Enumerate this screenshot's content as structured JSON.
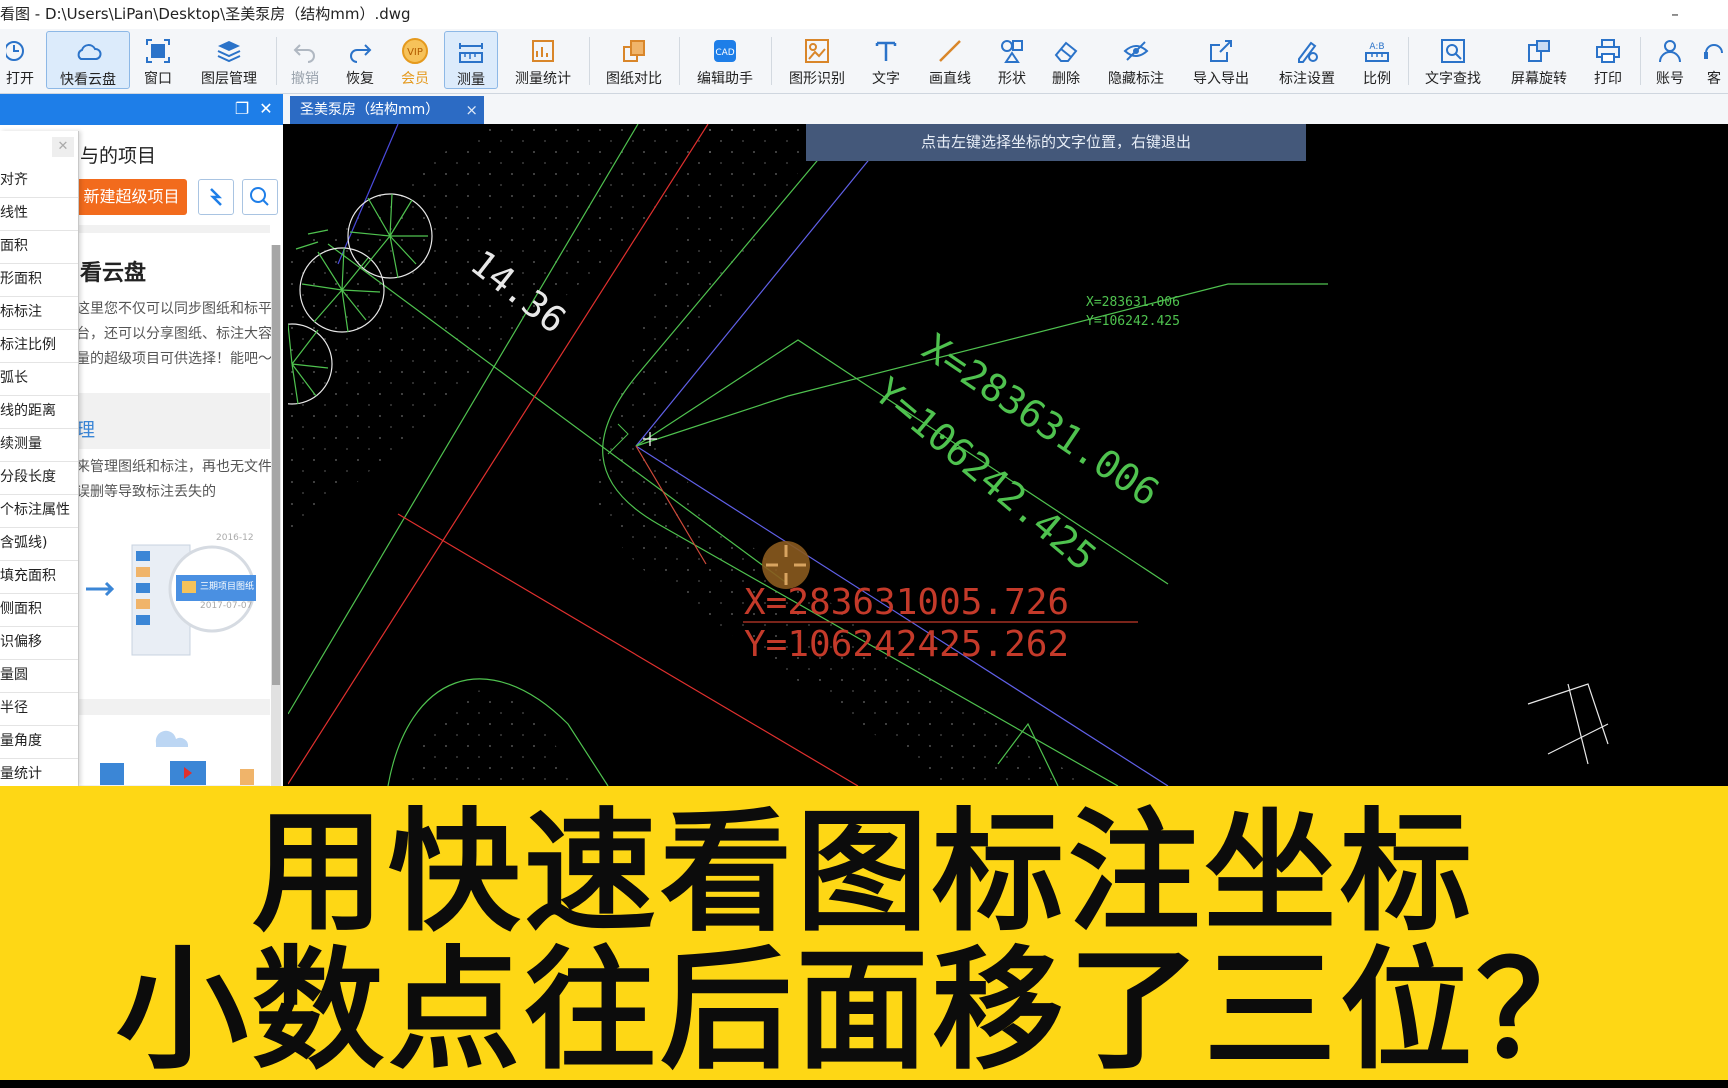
{
  "window": {
    "title": "看图 - D:\\Users\\LiPan\\Desktop\\圣美泵房（结构mm）.dwg",
    "minimize": "–"
  },
  "toolbar": {
    "items": [
      {
        "label": "打开",
        "icon": "clock-icon"
      },
      {
        "label": "快看云盘",
        "icon": "cloud-icon"
      },
      {
        "label": "窗口",
        "icon": "window-icon"
      },
      {
        "label": "图层管理",
        "icon": "layers-icon"
      },
      {
        "label": "撤销",
        "icon": "undo-icon"
      },
      {
        "label": "恢复",
        "icon": "redo-icon"
      },
      {
        "label": "会员",
        "icon": "vip-icon"
      },
      {
        "label": "测量",
        "icon": "ruler-icon"
      },
      {
        "label": "测量统计",
        "icon": "measure-stats-icon"
      },
      {
        "label": "图纸对比",
        "icon": "compare-icon"
      },
      {
        "label": "编辑助手",
        "icon": "cad-edit-icon"
      },
      {
        "label": "图形识别",
        "icon": "shape-recognize-icon"
      },
      {
        "label": "文字",
        "icon": "text-icon"
      },
      {
        "label": "画直线",
        "icon": "line-icon"
      },
      {
        "label": "形状",
        "icon": "shapes-icon"
      },
      {
        "label": "删除",
        "icon": "eraser-icon"
      },
      {
        "label": "隐藏标注",
        "icon": "eye-hide-icon"
      },
      {
        "label": "导入导出",
        "icon": "export-icon"
      },
      {
        "label": "标注设置",
        "icon": "annotation-settings-icon"
      },
      {
        "label": "比例",
        "icon": "scale-icon"
      },
      {
        "label": "文字查找",
        "icon": "text-search-icon"
      },
      {
        "label": "屏幕旋转",
        "icon": "rotate-screen-icon"
      },
      {
        "label": "打印",
        "icon": "print-icon"
      },
      {
        "label": "账号",
        "icon": "user-icon"
      },
      {
        "label": "客",
        "icon": "service-icon"
      }
    ]
  },
  "left_panel": {
    "project_title": "与的项目",
    "new_project": "新建超级项目",
    "cloud_title": "看云盘",
    "cloud_desc": "这里您不仅可以同步图纸和标平台，还可以分享图纸、标注大容量的超级项目可供选择！能吧～",
    "section2_title": "理",
    "section2_desc": "来管理图纸和标注，再也无文件误删等导致标注丢失的",
    "thumb_date1": "2016-12",
    "thumb_folder": "三期项目图纸",
    "thumb_date2": "2017-07-07"
  },
  "measure_menu": [
    "对齐",
    "线性",
    "面积",
    "形面积",
    "标标注",
    "标注比例",
    "弧长",
    "线的距离",
    "续测量",
    "分段长度",
    "个标注属性",
    "含弧线)",
    "填充面积",
    "侧面积",
    "识偏移",
    "量圆",
    "半径",
    "量角度",
    "量统计"
  ],
  "tab": {
    "name": "圣美泵房（结构mm）",
    "close": "×"
  },
  "canvas": {
    "hint": "点击左键选择坐标的文字位置，右键退出",
    "dim_text": "14.36",
    "small_x": "X=283631.006",
    "small_y": "Y=106242.425",
    "big_x": "X=283631.006",
    "big_y": "Y=106242.425",
    "red_x": "X=283631005.726",
    "red_y": "Y=106242425.262"
  },
  "banner": {
    "line1": "用快速看图标注坐标",
    "line2": "小数点往后面移了三位？"
  },
  "colors": {
    "toolbar_bg": "#f4f6f9",
    "panel_header": "#1e7ee8",
    "new_project": "#f26b1d",
    "tab_active": "#2c6bc4",
    "hint_bg": "#44587a",
    "banner": "#fed715",
    "cad_green": "#5fd05f",
    "cad_red": "#e0302e",
    "cad_blue": "#5a5adc",
    "coord_red": "#c43a2a"
  }
}
